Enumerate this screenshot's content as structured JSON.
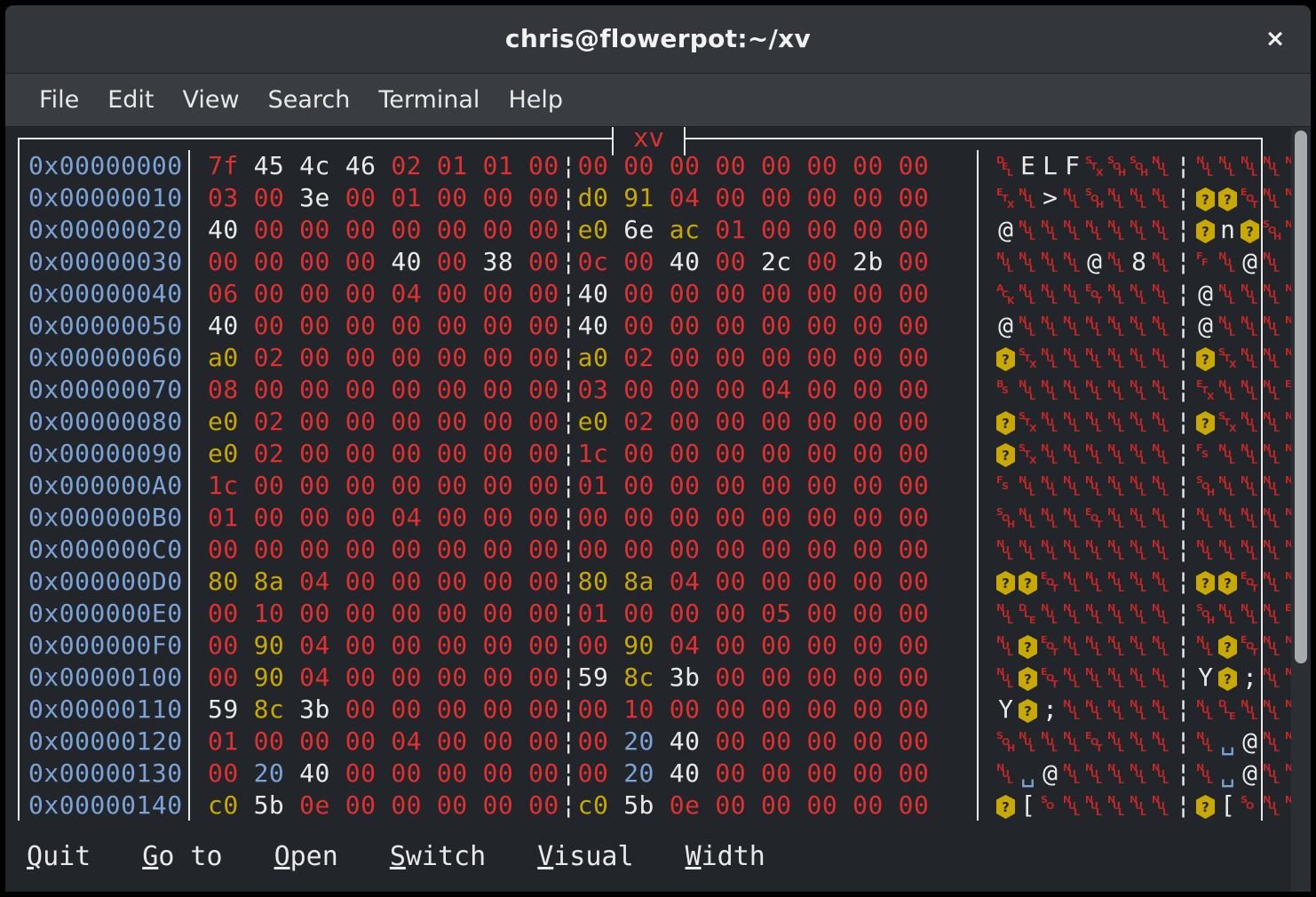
{
  "window": {
    "title": "chris@flowerpot:~/xv",
    "close_label": "×"
  },
  "menubar": {
    "items": [
      {
        "label": "File"
      },
      {
        "label": "Edit"
      },
      {
        "label": "View"
      },
      {
        "label": "Search"
      },
      {
        "label": "Terminal"
      },
      {
        "label": "Help"
      }
    ]
  },
  "editor": {
    "frame_title": "xv",
    "group_separator": "¦",
    "bytes_per_row": 16,
    "group_size": 8,
    "colors": {
      "address": "#7ba3d8",
      "nonprintable": "#e03030",
      "printable": "#e9e9e9",
      "high_byte": "#c9a800",
      "space": "#7ba3d8",
      "frame": "#e9e9e9",
      "background": "#22262a"
    },
    "rows": [
      {
        "address": "0x00000000",
        "bytes": [
          "7f",
          "45",
          "4c",
          "46",
          "02",
          "01",
          "01",
          "00",
          "00",
          "00",
          "00",
          "00",
          "00",
          "00",
          "00",
          "00"
        ]
      },
      {
        "address": "0x00000010",
        "bytes": [
          "03",
          "00",
          "3e",
          "00",
          "01",
          "00",
          "00",
          "00",
          "d0",
          "91",
          "04",
          "00",
          "00",
          "00",
          "00",
          "00"
        ]
      },
      {
        "address": "0x00000020",
        "bytes": [
          "40",
          "00",
          "00",
          "00",
          "00",
          "00",
          "00",
          "00",
          "e0",
          "6e",
          "ac",
          "01",
          "00",
          "00",
          "00",
          "00"
        ]
      },
      {
        "address": "0x00000030",
        "bytes": [
          "00",
          "00",
          "00",
          "00",
          "40",
          "00",
          "38",
          "00",
          "0c",
          "00",
          "40",
          "00",
          "2c",
          "00",
          "2b",
          "00"
        ]
      },
      {
        "address": "0x00000040",
        "bytes": [
          "06",
          "00",
          "00",
          "00",
          "04",
          "00",
          "00",
          "00",
          "40",
          "00",
          "00",
          "00",
          "00",
          "00",
          "00",
          "00"
        ]
      },
      {
        "address": "0x00000050",
        "bytes": [
          "40",
          "00",
          "00",
          "00",
          "00",
          "00",
          "00",
          "00",
          "40",
          "00",
          "00",
          "00",
          "00",
          "00",
          "00",
          "00"
        ]
      },
      {
        "address": "0x00000060",
        "bytes": [
          "a0",
          "02",
          "00",
          "00",
          "00",
          "00",
          "00",
          "00",
          "a0",
          "02",
          "00",
          "00",
          "00",
          "00",
          "00",
          "00"
        ]
      },
      {
        "address": "0x00000070",
        "bytes": [
          "08",
          "00",
          "00",
          "00",
          "00",
          "00",
          "00",
          "00",
          "03",
          "00",
          "00",
          "00",
          "04",
          "00",
          "00",
          "00"
        ]
      },
      {
        "address": "0x00000080",
        "bytes": [
          "e0",
          "02",
          "00",
          "00",
          "00",
          "00",
          "00",
          "00",
          "e0",
          "02",
          "00",
          "00",
          "00",
          "00",
          "00",
          "00"
        ]
      },
      {
        "address": "0x00000090",
        "bytes": [
          "e0",
          "02",
          "00",
          "00",
          "00",
          "00",
          "00",
          "00",
          "1c",
          "00",
          "00",
          "00",
          "00",
          "00",
          "00",
          "00"
        ]
      },
      {
        "address": "0x000000A0",
        "bytes": [
          "1c",
          "00",
          "00",
          "00",
          "00",
          "00",
          "00",
          "00",
          "01",
          "00",
          "00",
          "00",
          "00",
          "00",
          "00",
          "00"
        ]
      },
      {
        "address": "0x000000B0",
        "bytes": [
          "01",
          "00",
          "00",
          "00",
          "04",
          "00",
          "00",
          "00",
          "00",
          "00",
          "00",
          "00",
          "00",
          "00",
          "00",
          "00"
        ]
      },
      {
        "address": "0x000000C0",
        "bytes": [
          "00",
          "00",
          "00",
          "00",
          "00",
          "00",
          "00",
          "00",
          "00",
          "00",
          "00",
          "00",
          "00",
          "00",
          "00",
          "00"
        ]
      },
      {
        "address": "0x000000D0",
        "bytes": [
          "80",
          "8a",
          "04",
          "00",
          "00",
          "00",
          "00",
          "00",
          "80",
          "8a",
          "04",
          "00",
          "00",
          "00",
          "00",
          "00"
        ]
      },
      {
        "address": "0x000000E0",
        "bytes": [
          "00",
          "10",
          "00",
          "00",
          "00",
          "00",
          "00",
          "00",
          "01",
          "00",
          "00",
          "00",
          "05",
          "00",
          "00",
          "00"
        ]
      },
      {
        "address": "0x000000F0",
        "bytes": [
          "00",
          "90",
          "04",
          "00",
          "00",
          "00",
          "00",
          "00",
          "00",
          "90",
          "04",
          "00",
          "00",
          "00",
          "00",
          "00"
        ]
      },
      {
        "address": "0x00000100",
        "bytes": [
          "00",
          "90",
          "04",
          "00",
          "00",
          "00",
          "00",
          "00",
          "59",
          "8c",
          "3b",
          "00",
          "00",
          "00",
          "00",
          "00"
        ]
      },
      {
        "address": "0x00000110",
        "bytes": [
          "59",
          "8c",
          "3b",
          "00",
          "00",
          "00",
          "00",
          "00",
          "00",
          "10",
          "00",
          "00",
          "00",
          "00",
          "00",
          "00"
        ]
      },
      {
        "address": "0x00000120",
        "bytes": [
          "01",
          "00",
          "00",
          "00",
          "04",
          "00",
          "00",
          "00",
          "00",
          "20",
          "40",
          "00",
          "00",
          "00",
          "00",
          "00"
        ]
      },
      {
        "address": "0x00000130",
        "bytes": [
          "00",
          "20",
          "40",
          "00",
          "00",
          "00",
          "00",
          "00",
          "00",
          "20",
          "40",
          "00",
          "00",
          "00",
          "00",
          "00"
        ]
      },
      {
        "address": "0x00000140",
        "bytes": [
          "c0",
          "5b",
          "0e",
          "00",
          "00",
          "00",
          "00",
          "00",
          "c0",
          "5b",
          "0e",
          "00",
          "00",
          "00",
          "00",
          "00"
        ]
      }
    ]
  },
  "keybar": {
    "items": [
      {
        "accel": "Q",
        "rest": "uit"
      },
      {
        "accel": "G",
        "rest": "o to"
      },
      {
        "accel": "O",
        "rest": "pen"
      },
      {
        "accel": "S",
        "rest": "witch"
      },
      {
        "accel": "V",
        "rest": "isual"
      },
      {
        "accel": "W",
        "rest": "idth"
      }
    ]
  }
}
